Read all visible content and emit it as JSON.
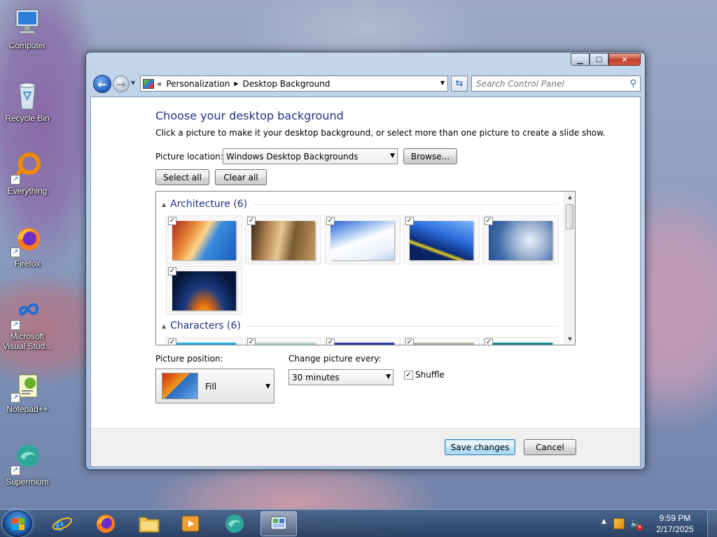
{
  "desktop": {
    "icons": [
      {
        "label": "Computer"
      },
      {
        "label": "Recycle Bin"
      },
      {
        "label": "Everything"
      },
      {
        "label": "Firefox"
      },
      {
        "label": "Microsoft Visual Stud..."
      },
      {
        "label": "Notepad++"
      },
      {
        "label": "Supermium"
      }
    ]
  },
  "window": {
    "breadcrumb_prefix": "«",
    "breadcrumbs": [
      "Personalization",
      "Desktop Background"
    ],
    "search_placeholder": "Search Control Panel",
    "title": "Choose your desktop background",
    "subtitle": "Click a picture to make it your desktop background, or select more than one picture to create a slide show.",
    "picture_location_label": "Picture location:",
    "picture_location_value": "Windows Desktop Backgrounds",
    "browse_label": "Browse...",
    "select_all_label": "Select all",
    "clear_all_label": "Clear all",
    "groups": [
      {
        "name": "Architecture (6)",
        "count": 6,
        "checked": [
          true,
          true,
          true,
          true,
          true,
          true
        ]
      },
      {
        "name": "Characters (6)",
        "count": 6,
        "checked": [
          true,
          true,
          true,
          true,
          true
        ]
      }
    ],
    "picture_position_label": "Picture position:",
    "picture_position_value": "Fill",
    "change_picture_label": "Change picture every:",
    "change_picture_value": "30 minutes",
    "shuffle_label": "Shuffle",
    "shuffle_checked": true,
    "save_label": "Save changes",
    "cancel_label": "Cancel"
  },
  "taskbar": {
    "apps": [
      "internet-explorer",
      "firefox",
      "file-explorer",
      "media-player",
      "supermium",
      "control-panel"
    ],
    "active_app": "control-panel",
    "time": "9:59 PM",
    "date": "2/17/2025"
  },
  "colors": {
    "heading": "#1e3287",
    "accent": "#3c7fb1"
  }
}
